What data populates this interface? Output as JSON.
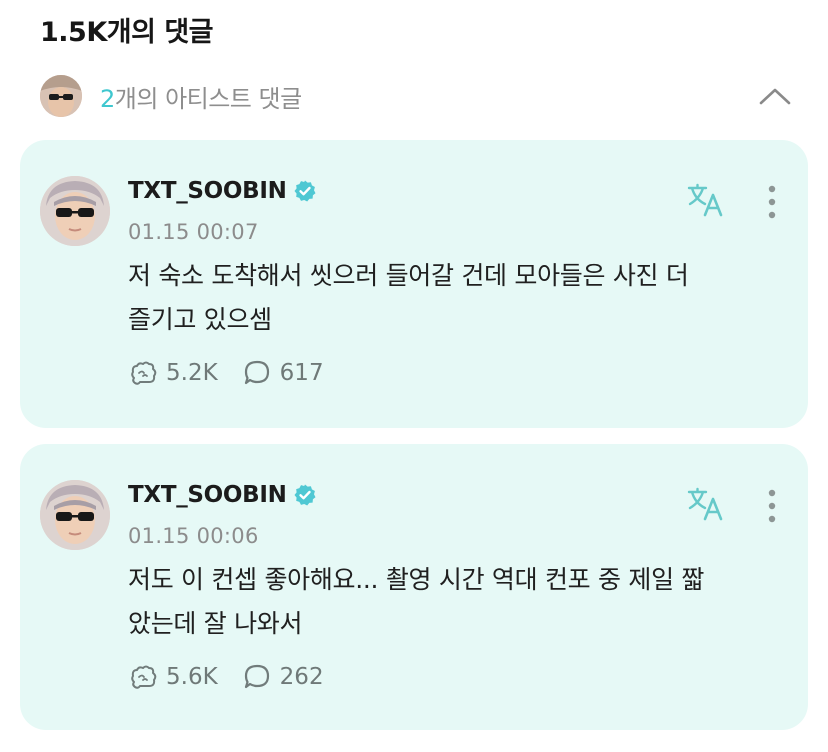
{
  "header": {
    "title": "1.5K개의 댓글"
  },
  "artist_comments": {
    "count": "2",
    "label": "개의 아티스트 댓글",
    "toggle_icon": "chevron-up-icon"
  },
  "comments": [
    {
      "author": "TXT_SOOBIN",
      "verified_icon": "verified-badge-icon",
      "timestamp": "01.15 00:07",
      "text_line1": "저 숙소 도착해서 씻으러 들어갈 건데 모아들은 사진 더",
      "text_line2": "즐기고 있으셈",
      "likes": "5.2K",
      "replies": "617"
    },
    {
      "author": "TXT_SOOBIN",
      "verified_icon": "verified-badge-icon",
      "timestamp": "01.15 00:06",
      "text_line1": "저도 이 컨셉 좋아해요... 촬영 시간 역대 컨포 중 제일 짧",
      "text_line2": "았는데 잘 나와서",
      "likes": "5.6K",
      "replies": "262"
    }
  ],
  "colors": {
    "card_bg": "#e6f9f6",
    "accent": "#3fc7cf",
    "verified": "#4fc8d3",
    "muted_text": "#8c8c8c"
  }
}
